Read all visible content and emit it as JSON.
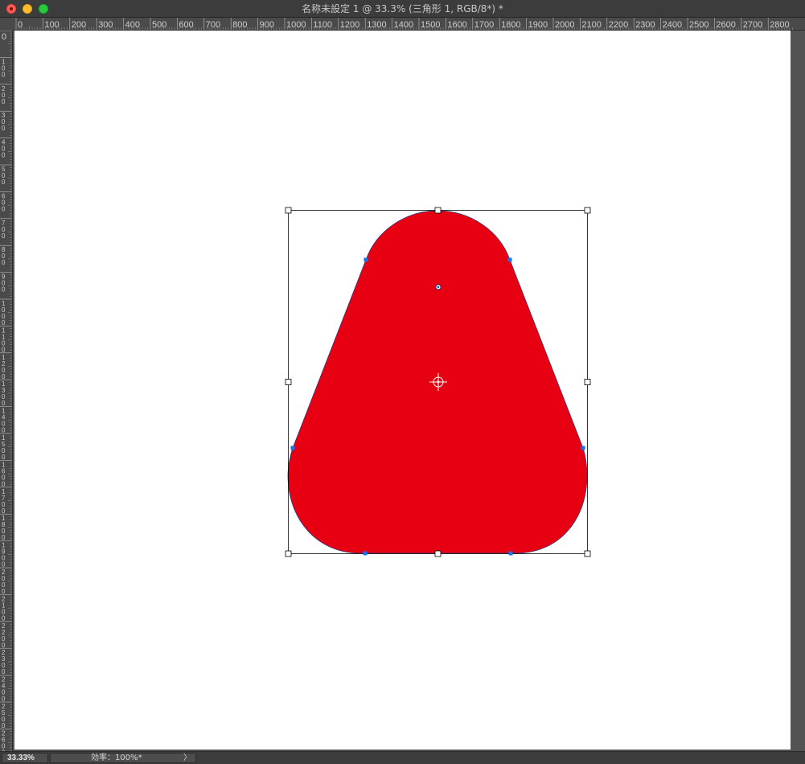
{
  "window": {
    "title": "名称未設定 1 @ 33.3% (三角形 1, RGB/8*) *"
  },
  "rulers": {
    "horizontal_labels": [
      "0",
      "100",
      "200",
      "300",
      "400",
      "500",
      "600",
      "700",
      "800",
      "900",
      "1000",
      "1100",
      "1200",
      "1300",
      "1400",
      "1500",
      "1600",
      "1700",
      "1800",
      "1900",
      "2000",
      "2100",
      "2200",
      "2300",
      "2400",
      "2500",
      "2600",
      "2700",
      "2800"
    ],
    "vertical_labels": [
      "0",
      "1\n0\n0",
      "2\n0\n0",
      "3\n0\n0",
      "4\n0\n0",
      "5\n0\n0",
      "6\n0\n0",
      "7\n0\n0",
      "8\n0\n0",
      "9\n0\n0",
      "1\n0\n0\n0",
      "1\n1\n0\n0",
      "1\n2\n0\n0",
      "1\n3\n0\n0",
      "1\n4\n0\n0",
      "1\n5\n0\n0",
      "1\n6\n0\n0",
      "1\n7\n0\n0",
      "1\n8\n0\n0",
      "1\n9\n0\n0",
      "2\n0\n0\n0",
      "2\n1\n0\n0",
      "2\n2\n0\n0",
      "2\n3\n0\n0",
      "2\n4\n0\n0",
      "2\n5\n0\n0",
      "2\n6\n0\n0"
    ]
  },
  "shape": {
    "layer_name": "三角形 1",
    "fill_color": "#e60012",
    "path_color": "#1f3a8a",
    "anchor_color": "#1a73e8",
    "bbox_color": "#000000"
  },
  "statusbar": {
    "zoom": "33.33%",
    "info": "効率：100%*",
    "arrow": "〉"
  }
}
